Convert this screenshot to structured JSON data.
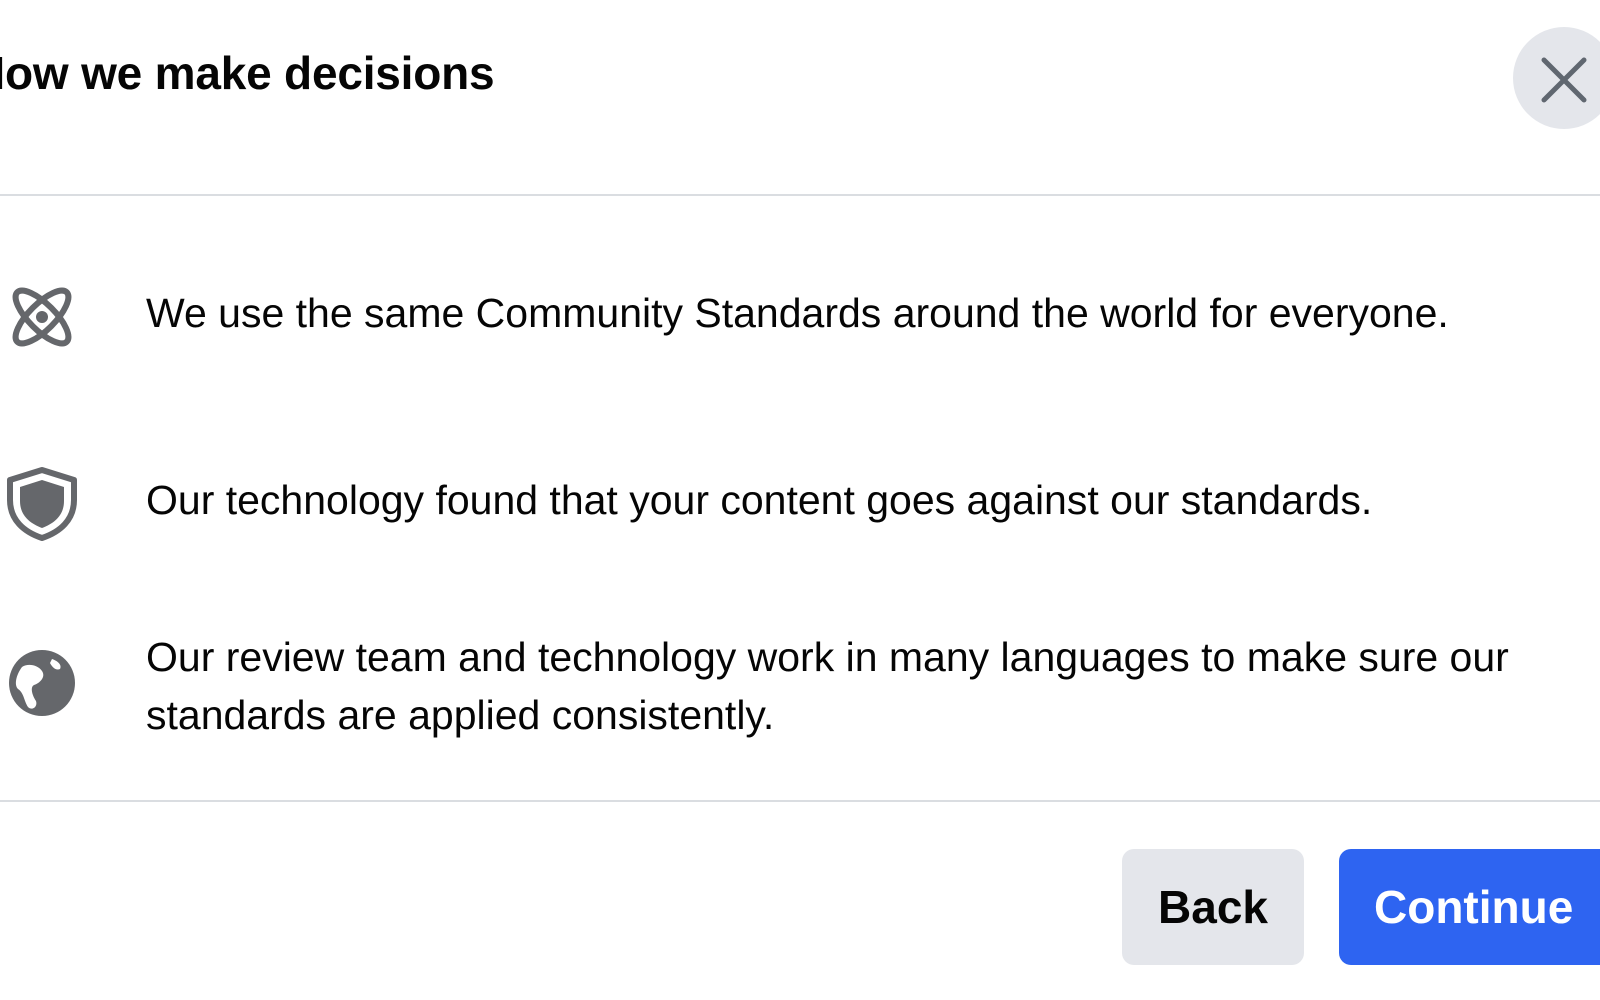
{
  "dialog": {
    "title": "How we make decisions",
    "close_icon": "close-icon"
  },
  "items": [
    {
      "icon": "atom-icon",
      "text": "We use the same Community Standards around the world for everyone."
    },
    {
      "icon": "shield-icon",
      "text": "Our technology found that your content goes against our standards."
    },
    {
      "icon": "globe-icon",
      "text": "Our review team and technology work in many languages to make sure our standards are applied consistently."
    }
  ],
  "footer": {
    "back_label": "Back",
    "continue_label": "Continue"
  },
  "colors": {
    "primary_button": "#2e64f1",
    "secondary_button": "#e4e6eb",
    "icon_gray": "#65676b",
    "text": "#050505"
  }
}
